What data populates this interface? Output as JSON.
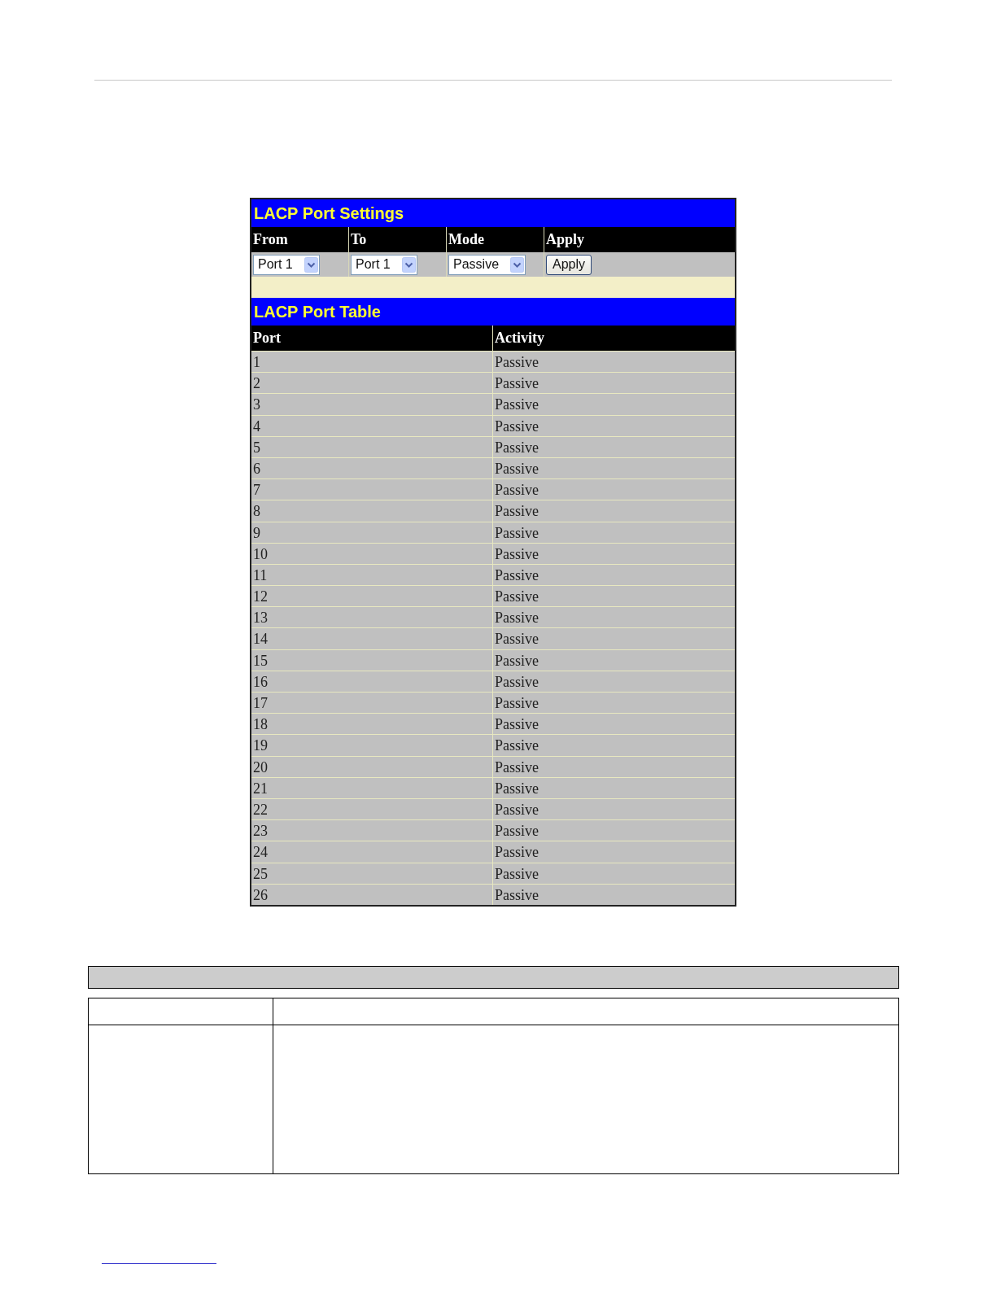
{
  "settings": {
    "title": "LACP Port Settings",
    "columns": [
      "From",
      "To",
      "Mode",
      "Apply"
    ],
    "controls": [
      {
        "kind": "select",
        "value": "Port 1"
      },
      {
        "kind": "select",
        "value": "Port 1"
      },
      {
        "kind": "select",
        "value": "Passive"
      },
      {
        "kind": "button",
        "value": "Apply"
      }
    ]
  },
  "port_table": {
    "title": "LACP Port Table",
    "columns": [
      "Port",
      "Activity"
    ],
    "rows": [
      [
        "1",
        "Passive"
      ],
      [
        "2",
        "Passive"
      ],
      [
        "3",
        "Passive"
      ],
      [
        "4",
        "Passive"
      ],
      [
        "5",
        "Passive"
      ],
      [
        "6",
        "Passive"
      ],
      [
        "7",
        "Passive"
      ],
      [
        "8",
        "Passive"
      ],
      [
        "9",
        "Passive"
      ],
      [
        "10",
        "Passive"
      ],
      [
        "11",
        "Passive"
      ],
      [
        "12",
        "Passive"
      ],
      [
        "13",
        "Passive"
      ],
      [
        "14",
        "Passive"
      ],
      [
        "15",
        "Passive"
      ],
      [
        "16",
        "Passive"
      ],
      [
        "17",
        "Passive"
      ],
      [
        "18",
        "Passive"
      ],
      [
        "19",
        "Passive"
      ],
      [
        "20",
        "Passive"
      ],
      [
        "21",
        "Passive"
      ],
      [
        "22",
        "Passive"
      ],
      [
        "23",
        "Passive"
      ],
      [
        "24",
        "Passive"
      ],
      [
        "25",
        "Passive"
      ],
      [
        "26",
        "Passive"
      ]
    ]
  }
}
